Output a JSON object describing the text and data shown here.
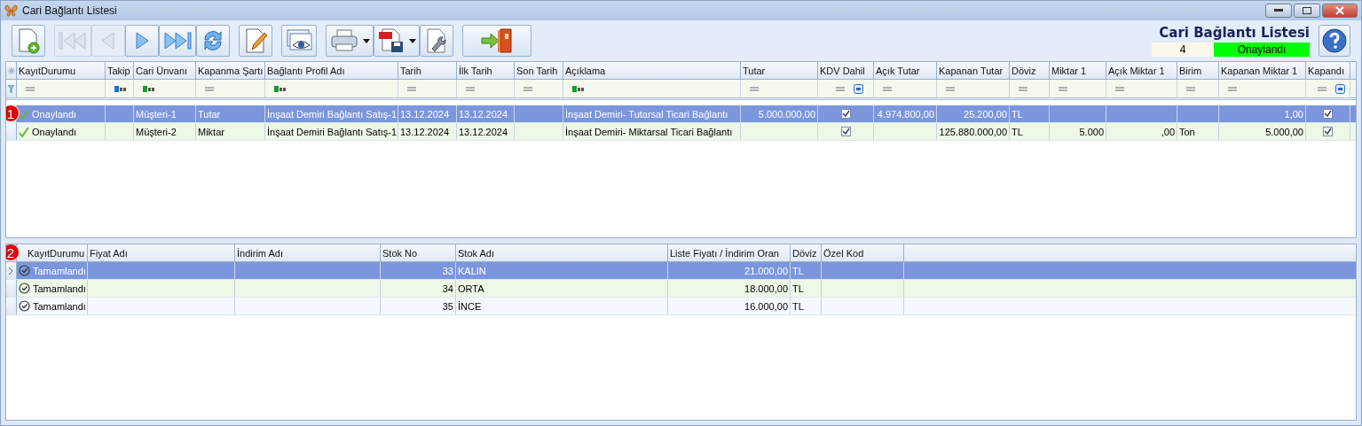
{
  "window": {
    "title": "Cari Bağlantı Listesi"
  },
  "toolbar": [
    {
      "kind": "new",
      "disabled": false,
      "dropdown": false
    },
    {
      "kind": "first",
      "disabled": true,
      "dropdown": false
    },
    {
      "kind": "prev",
      "disabled": true,
      "dropdown": false
    },
    {
      "kind": "next",
      "disabled": false,
      "dropdown": false
    },
    {
      "kind": "last",
      "disabled": false,
      "dropdown": false
    },
    {
      "kind": "refresh",
      "disabled": false,
      "dropdown": false
    },
    {
      "kind": "edit",
      "disabled": false,
      "dropdown": false
    },
    {
      "kind": "preview",
      "disabled": false,
      "dropdown": false
    },
    {
      "kind": "print",
      "disabled": false,
      "dropdown": true
    },
    {
      "kind": "pdf",
      "disabled": false,
      "dropdown": true
    },
    {
      "kind": "settings",
      "disabled": false,
      "dropdown": false
    },
    {
      "kind": "exit",
      "disabled": false,
      "dropdown": false
    }
  ],
  "header": {
    "title": "Cari Bağlantı Listesi",
    "count": "4",
    "status": {
      "text": "Onaylandı",
      "color": "#00ff00"
    }
  },
  "grids": [
    {
      "badge": "1",
      "columns": [
        {
          "label": "KayıtDurumu",
          "kind": "status",
          "filter": {
            "kind": "eq"
          }
        },
        {
          "label": "Takip",
          "kind": "text",
          "filter": {
            "kind": "abc",
            "color": "#1c6fd8"
          }
        },
        {
          "label": "Cari Ünvanı",
          "kind": "text",
          "filter": {
            "kind": "abc",
            "color": "#1a9a30"
          }
        },
        {
          "label": "Kapanma Şartı",
          "kind": "text",
          "filter": {
            "kind": "eq"
          }
        },
        {
          "label": "Bağlantı Profil Adı",
          "kind": "text",
          "filter": {
            "kind": "abc",
            "color": "#1a9a30"
          }
        },
        {
          "label": "Tarih",
          "kind": "text",
          "filter": {
            "kind": "eq"
          }
        },
        {
          "label": "İlk Tarih",
          "kind": "text",
          "filter": {
            "kind": "eq"
          }
        },
        {
          "label": "Son Tarih",
          "kind": "text",
          "filter": {
            "kind": "eq"
          }
        },
        {
          "label": "Açıklama",
          "kind": "text",
          "filter": {
            "kind": "abc",
            "color": "#1a9a30"
          }
        },
        {
          "label": "Tutar",
          "kind": "number",
          "filter": {
            "kind": "eq"
          }
        },
        {
          "label": "KDV Dahil",
          "kind": "check",
          "filter": {
            "kind": "check"
          }
        },
        {
          "label": "Açık Tutar",
          "kind": "number",
          "filter": {
            "kind": "eq"
          }
        },
        {
          "label": "Kapanan Tutar",
          "kind": "number",
          "filter": {
            "kind": "eq"
          }
        },
        {
          "label": "Döviz",
          "kind": "text",
          "filter": {
            "kind": "eq"
          }
        },
        {
          "label": "Miktar 1",
          "kind": "number",
          "filter": {
            "kind": "eq"
          }
        },
        {
          "label": "Açık Miktar 1",
          "kind": "number",
          "filter": {
            "kind": "eq"
          }
        },
        {
          "label": "Birim",
          "kind": "text",
          "filter": {
            "kind": "eq"
          }
        },
        {
          "label": "Kapanan Miktar 1",
          "kind": "number",
          "filter": {
            "kind": "eq"
          }
        },
        {
          "label": "Kapandı",
          "kind": "check",
          "filter": {
            "kind": "check"
          }
        }
      ],
      "rows": [
        {
          "selected": true,
          "current": false,
          "cells": [
            "Onaylandı",
            null,
            "Müşteri-1",
            "Tutar",
            "İnşaat Demiri Bağlantı Satış-1",
            "13.12.2024",
            "13.12.2024",
            null,
            "İnşaat Demiri- Tutarsal Ticari Bağlantı",
            "5.000.000,00",
            true,
            "4.974.800,00",
            "25.200,00",
            "TL",
            null,
            null,
            null,
            "1,00",
            true
          ]
        },
        {
          "selected": false,
          "current": false,
          "cells": [
            "Onaylandı",
            null,
            "Müşteri-2",
            "Miktar",
            "İnşaat Demiri Bağlantı Satış-1",
            "13.12.2024",
            "13.12.2024",
            null,
            "İnşaat Demiri- Miktarsal Ticari Bağlantı",
            null,
            true,
            null,
            "125.880.000,00",
            "TL",
            "5.000",
            ",00",
            "Ton",
            "5.000,00",
            true
          ]
        }
      ]
    },
    {
      "badge": "2",
      "columns": [
        {
          "label": "KayıtDurumu",
          "kind": "done"
        },
        {
          "label": "Fiyat Adı",
          "kind": "text"
        },
        {
          "label": "İndirim Adı",
          "kind": "text"
        },
        {
          "label": "Stok No",
          "kind": "number"
        },
        {
          "label": "Stok Adı",
          "kind": "text"
        },
        {
          "label": "Liste Fiyatı / İndirim Oran",
          "kind": "number"
        },
        {
          "label": "Döviz",
          "kind": "text"
        },
        {
          "label": "Özel Kod",
          "kind": "text"
        }
      ],
      "rows": [
        {
          "selected": true,
          "current": true,
          "cells": [
            "Tamamlandı",
            null,
            null,
            "33",
            "KALIN",
            "21.000,00",
            "TL",
            null
          ]
        },
        {
          "selected": false,
          "current": false,
          "cells": [
            "Tamamlandı",
            null,
            null,
            "34",
            "ORTA",
            "18.000,00",
            "TL",
            null
          ]
        },
        {
          "selected": false,
          "current": false,
          "cells": [
            "Tamamlandı",
            null,
            null,
            "35",
            "İNCE",
            "16.000,00",
            "TL",
            null
          ]
        }
      ]
    }
  ]
}
